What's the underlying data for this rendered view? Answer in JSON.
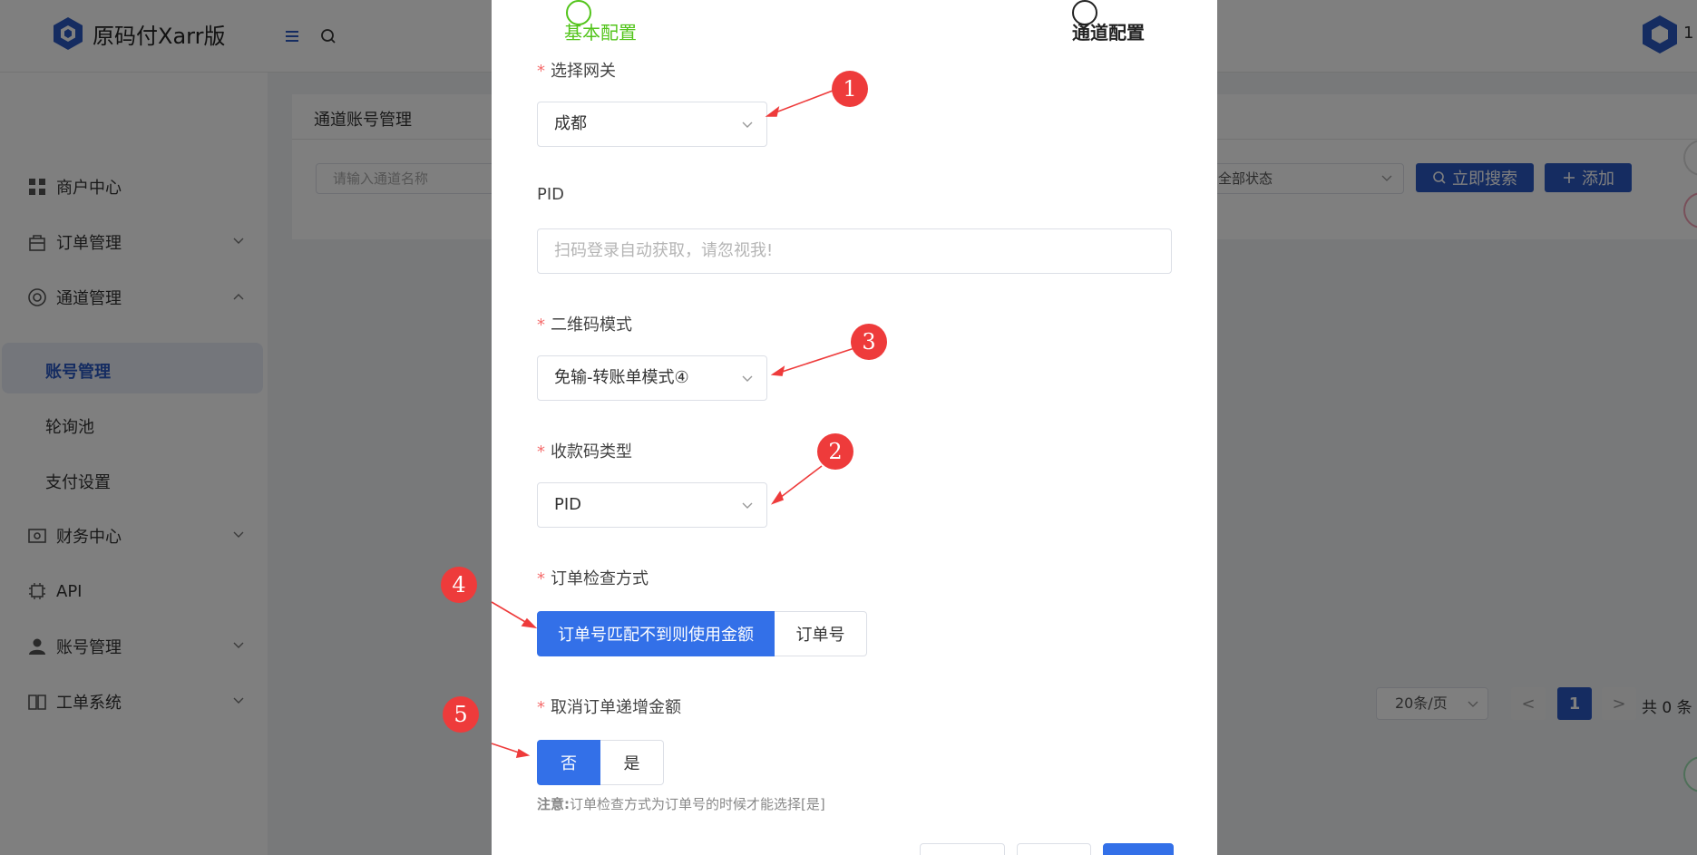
{
  "app": {
    "title": "原码付Xarr版",
    "avatar_text": "1"
  },
  "sidebar": {
    "items": [
      {
        "label": "商户中心",
        "icon": "grid-icon"
      },
      {
        "label": "订单管理",
        "icon": "bag-icon"
      },
      {
        "label": "通道管理",
        "icon": "lifebuoy-icon"
      },
      {
        "label": "财务中心",
        "icon": "wallet-icon"
      },
      {
        "label": "API",
        "icon": "chip-icon"
      },
      {
        "label": "账号管理",
        "icon": "user-icon"
      },
      {
        "label": "工单系统",
        "icon": "book-icon"
      }
    ],
    "sub_items": [
      "账号管理",
      "轮询池",
      "支付设置"
    ]
  },
  "card": {
    "title": "通道账号管理",
    "search_placeholder": "请输入通道名称",
    "status_select": "全部状态",
    "search_button": "立即搜索",
    "add_button": "添加"
  },
  "pager": {
    "page_size": "20条/页",
    "prev": "<",
    "current": "1",
    "next": ">",
    "total": "共 0 条"
  },
  "modal": {
    "steps": [
      "基本配置",
      "通道配置"
    ],
    "fields": {
      "gateway": {
        "label": "选择网关",
        "value": "成都"
      },
      "pid": {
        "label": "PID",
        "placeholder": "扫码登录自动获取，请忽视我!"
      },
      "qr_mode": {
        "label": "二维码模式",
        "value": "免输-转账单模式④"
      },
      "code_type": {
        "label": "收款码类型",
        "value": "PID"
      },
      "order_check": {
        "label": "订单检查方式",
        "options": [
          "订单号匹配不到则使用金额",
          "订单号"
        ],
        "selected": "订单号匹配不到则使用金额"
      },
      "cancel_increment": {
        "label": "取消订单递增金额",
        "options": [
          "否",
          "是"
        ],
        "selected": "否"
      }
    },
    "note_prefix": "注意:",
    "note_text": "订单检查方式为订单号的时候才能选择[是]"
  },
  "annotations": [
    "1",
    "2",
    "3",
    "4",
    "5"
  ],
  "colors": {
    "primary": "#2b59c3",
    "modal_primary": "#3370e8",
    "success": "#52c41a",
    "required": "#f56c6c",
    "annotation": "#ee3b3b"
  }
}
